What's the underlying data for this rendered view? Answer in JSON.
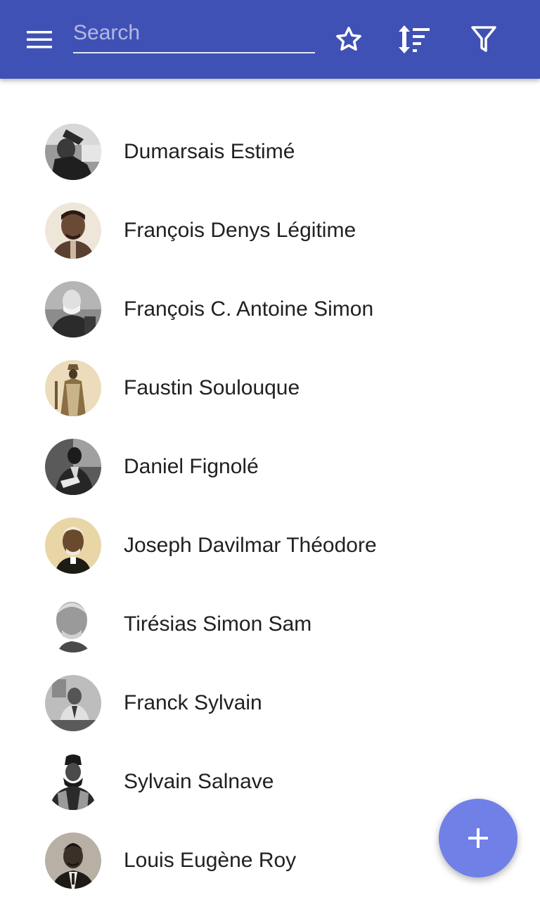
{
  "appbar": {
    "color": "#3f51b5",
    "menu_icon": "menu-icon",
    "search": {
      "placeholder": "Search",
      "value": ""
    },
    "actions": [
      "star-icon",
      "sort-icon",
      "filter-icon"
    ]
  },
  "items": [
    {
      "name": "Dumarsais Estimé",
      "avatar": "portrait-photo"
    },
    {
      "name": "François Denys Légitime",
      "avatar": "portrait-photo"
    },
    {
      "name": "François C. Antoine Simon",
      "avatar": "portrait-photo"
    },
    {
      "name": "Faustin Soulouque",
      "avatar": "portrait-photo"
    },
    {
      "name": "Daniel Fignolé",
      "avatar": "portrait-photo"
    },
    {
      "name": "Joseph Davilmar Théodore",
      "avatar": "portrait-photo"
    },
    {
      "name": "Tirésias Simon Sam",
      "avatar": "portrait-photo"
    },
    {
      "name": "Franck Sylvain",
      "avatar": "portrait-photo"
    },
    {
      "name": "Sylvain Salnave",
      "avatar": "portrait-photo"
    },
    {
      "name": "Louis Eugène Roy",
      "avatar": "portrait-photo"
    }
  ],
  "fab": {
    "icon": "plus-icon",
    "color": "#7080e6"
  }
}
